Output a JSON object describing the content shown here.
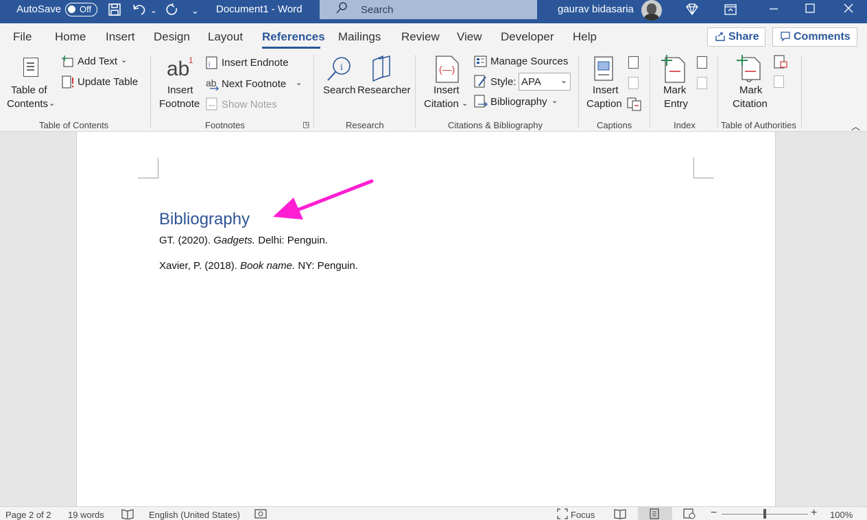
{
  "titlebar": {
    "autosave_label": "AutoSave",
    "autosave_state": "Off",
    "document_title": "Document1  -  Word",
    "search_placeholder": "Search",
    "user_name": "gaurav bidasaria"
  },
  "tabs": [
    "File",
    "Home",
    "Insert",
    "Design",
    "Layout",
    "References",
    "Mailings",
    "Review",
    "View",
    "Developer",
    "Help"
  ],
  "active_tab": "References",
  "share_label": "Share",
  "comments_label": "Comments",
  "ribbon": {
    "toc": {
      "table_of_contents_line1": "Table of",
      "table_of_contents_line2": "Contents",
      "add_text": "Add Text",
      "update_table": "Update Table",
      "group_label": "Table of Contents"
    },
    "footnotes": {
      "insert_footnote_line1": "Insert",
      "insert_footnote_line2": "Footnote",
      "insert_endnote": "Insert Endnote",
      "next_footnote": "Next Footnote",
      "show_notes": "Show Notes",
      "group_label": "Footnotes"
    },
    "research": {
      "search": "Search",
      "researcher": "Researcher",
      "group_label": "Research"
    },
    "citations": {
      "insert_citation_line1": "Insert",
      "insert_citation_line2": "Citation",
      "manage_sources": "Manage Sources",
      "style_label": "Style:",
      "style_value": "APA",
      "bibliography": "Bibliography",
      "group_label": "Citations & Bibliography"
    },
    "captions": {
      "insert_caption_line1": "Insert",
      "insert_caption_line2": "Caption",
      "group_label": "Captions"
    },
    "index": {
      "mark_entry_line1": "Mark",
      "mark_entry_line2": "Entry",
      "group_label": "Index"
    },
    "authorities": {
      "mark_citation_line1": "Mark",
      "mark_citation_line2": "Citation",
      "group_label": "Table of Authorities"
    }
  },
  "document": {
    "heading": "Bibliography",
    "entries": [
      {
        "pre": "GT. (2020). ",
        "italic": "Gadgets.",
        "post": " Delhi: Penguin."
      },
      {
        "pre": "Xavier, P. (2018). ",
        "italic": "Book name.",
        "post": " NY: Penguin."
      }
    ]
  },
  "statusbar": {
    "page": "Page 2 of 2",
    "words": "19 words",
    "language": "English (United States)",
    "focus": "Focus",
    "zoom": "100%"
  },
  "colors": {
    "titlebar": "#2b579a",
    "accent": "#2b579a",
    "heading": "#2f5496",
    "arrow": "#ff1fd2"
  }
}
